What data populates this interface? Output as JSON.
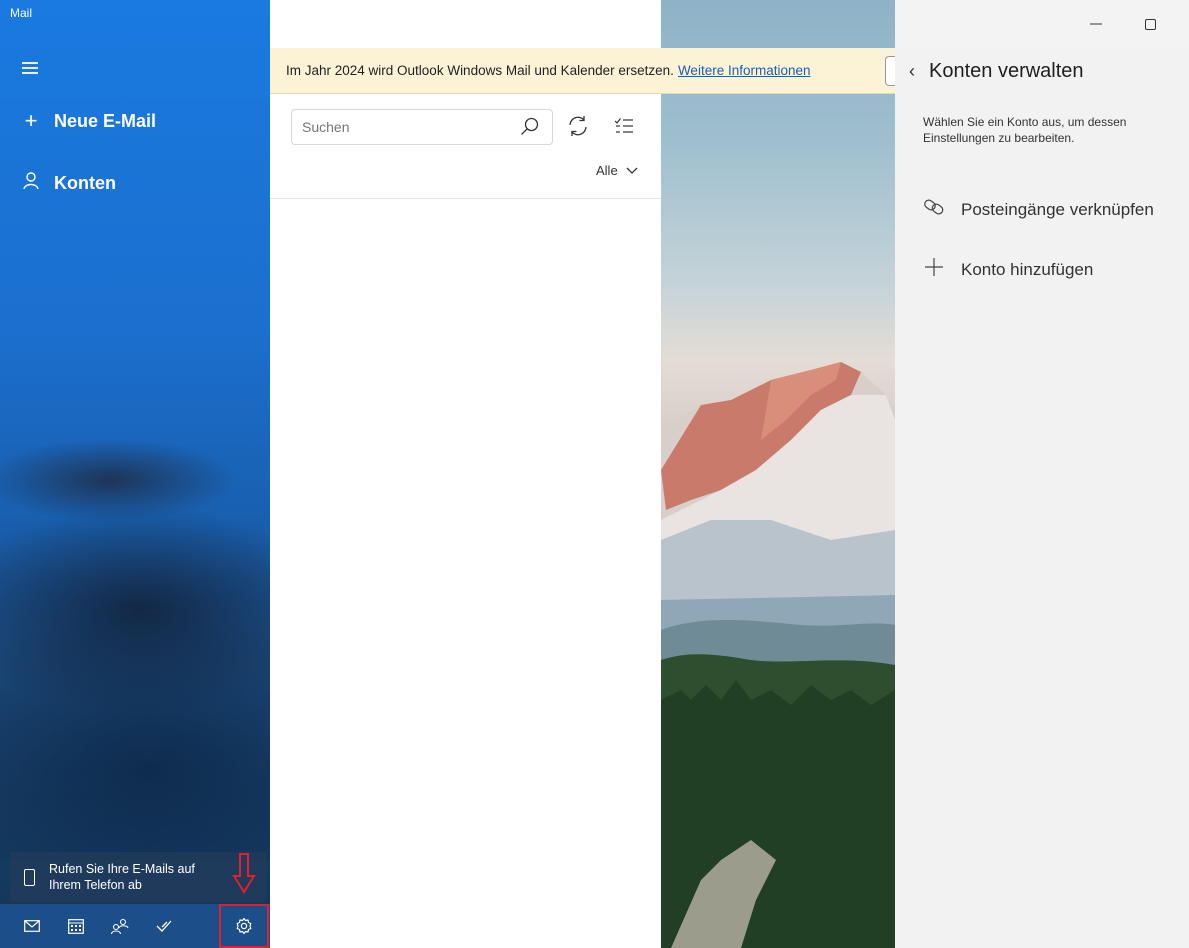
{
  "app": {
    "title": "Mail"
  },
  "nav": {
    "new_mail": "Neue E-Mail",
    "accounts": "Konten",
    "phone_banner": [
      "Rufen Sie Ihre E-Mails auf",
      "Ihrem Telefon ab"
    ],
    "bottom_icons": [
      "mail-icon",
      "calendar-icon",
      "people-icon",
      "todo-icon",
      "settings-icon"
    ]
  },
  "banner": {
    "text": "Im Jahr 2024 wird Outlook Windows Mail und Kalender ersetzen.",
    "link": "Weitere Informationen"
  },
  "list": {
    "search_placeholder": "Suchen",
    "filter": "Alle"
  },
  "panel": {
    "title": "Konten verwalten",
    "description": "Wählen Sie ein Konto aus, um dessen Einstellungen zu bearbeiten.",
    "actions": [
      "Posteingänge verknüpfen",
      "Konto hinzufügen"
    ]
  },
  "colors": {
    "nav_blue": "#1a7ae0",
    "banner_bg": "#fcf3d6",
    "highlight_red": "#e0202c",
    "panel_bg": "#f2f2f2"
  }
}
